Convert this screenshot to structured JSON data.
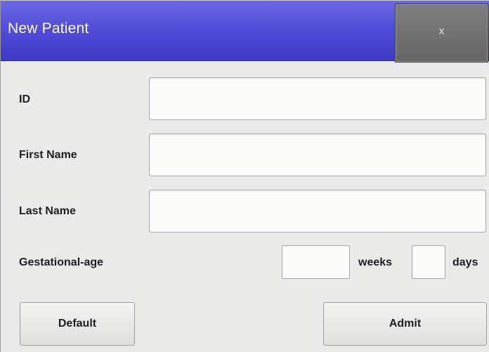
{
  "window": {
    "title": "New Patient",
    "close_label": "x"
  },
  "form": {
    "id_label": "ID",
    "id_value": "",
    "first_name_label": "First Name",
    "first_name_value": "",
    "last_name_label": "Last Name",
    "last_name_value": "",
    "gestational_age_label": "Gestational-age",
    "weeks_value": "",
    "weeks_unit": "weeks",
    "days_value": "",
    "days_unit": "days"
  },
  "buttons": {
    "default_label": "Default",
    "admit_label": "Admit"
  },
  "colors": {
    "titlebar": "#4d48d6",
    "background": "#eaebe8"
  }
}
